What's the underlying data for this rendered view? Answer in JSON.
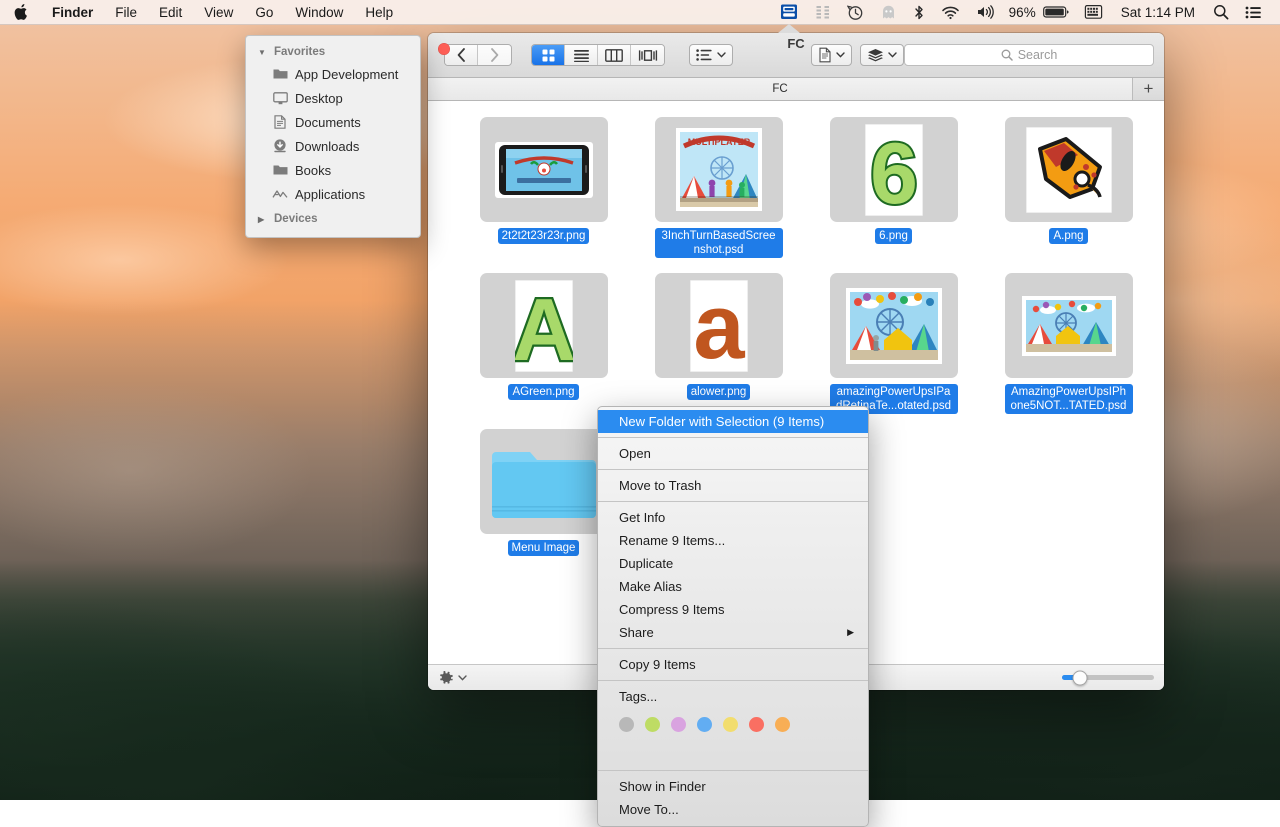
{
  "menubar": {
    "apple_glyph": "",
    "items": [
      {
        "label": "Finder",
        "bold": true
      },
      {
        "label": "File",
        "bold": false
      },
      {
        "label": "Edit",
        "bold": false
      },
      {
        "label": "View",
        "bold": false
      },
      {
        "label": "Go",
        "bold": false
      },
      {
        "label": "Window",
        "bold": false
      },
      {
        "label": "Help",
        "bold": false
      }
    ],
    "status": {
      "battery_percent": "96%",
      "clock": "Sat 1:14 PM"
    },
    "status_icons": [
      "finder-menu-extra-icon",
      "sort-arrows-icon",
      "time-machine-icon",
      "ghost-icon",
      "bluetooth-icon",
      "wifi-icon",
      "volume-icon",
      "battery-icon",
      "keyboard-input-icon",
      "spotlight-search-icon",
      "notification-center-icon"
    ]
  },
  "finder": {
    "window_title": "FC",
    "tab_title": "FC",
    "tab_add_label": "+",
    "nav": {
      "back": "‹",
      "forward": "›"
    },
    "view_modes": [
      {
        "name": "icon-view",
        "selected": true
      },
      {
        "name": "list-view",
        "selected": false
      },
      {
        "name": "column-view",
        "selected": false
      },
      {
        "name": "coverflow-view",
        "selected": false
      }
    ],
    "search": {
      "placeholder": "Search",
      "value": ""
    },
    "zoom_slider": {
      "value": 20
    },
    "action_gear_label": "⚙"
  },
  "sidebar": {
    "sections": [
      {
        "title": "Favorites",
        "expanded": true,
        "disclosure": "▼",
        "items": [
          {
            "label": "App Development",
            "icon": "folder-icon"
          },
          {
            "label": "Desktop",
            "icon": "display-icon"
          },
          {
            "label": "Documents",
            "icon": "document-icon"
          },
          {
            "label": "Downloads",
            "icon": "downloads-icon"
          },
          {
            "label": "Books",
            "icon": "folder-icon"
          },
          {
            "label": "Applications",
            "icon": "applications-icon"
          }
        ]
      },
      {
        "title": "Devices",
        "expanded": false,
        "disclosure": "▶",
        "items": []
      }
    ]
  },
  "files": [
    {
      "name": "2t2t2t23r23r.png",
      "kind": "png",
      "selected": true,
      "thumb": "phone-laugh-clown"
    },
    {
      "name": "3InchTurnBasedScreenshot.psd",
      "kind": "psd",
      "selected": true,
      "thumb": "multiplayer-carnival"
    },
    {
      "name": "6.png",
      "kind": "png",
      "selected": true,
      "thumb": "green-six"
    },
    {
      "name": "A.png",
      "kind": "png",
      "selected": true,
      "thumb": "orange-a-graffiti"
    },
    {
      "name": "AGreen.png",
      "kind": "png",
      "selected": true,
      "thumb": "green-a"
    },
    {
      "name": "alower.png",
      "kind": "png",
      "selected": true,
      "thumb": "orange-a-lower"
    },
    {
      "name": "amazingPowerUpsIPadRetinaTe...otated.psd",
      "kind": "psd",
      "selected": true,
      "thumb": "carnival-ipad"
    },
    {
      "name": "AmazingPowerUpsIPhone5NOT...TATED.psd",
      "kind": "psd",
      "selected": true,
      "thumb": "carnival-iphone"
    },
    {
      "name": "Menu Image",
      "kind": "folder",
      "selected": true,
      "thumb": "blue-folder"
    }
  ],
  "context_menu": {
    "groups": [
      {
        "items": [
          {
            "label": "New Folder with Selection (9 Items)",
            "highlighted": true,
            "submenu": false
          }
        ]
      },
      {
        "items": [
          {
            "label": "Open",
            "highlighted": false,
            "submenu": false
          }
        ]
      },
      {
        "items": [
          {
            "label": "Move to Trash",
            "highlighted": false,
            "submenu": false
          }
        ]
      },
      {
        "items": [
          {
            "label": "Get Info",
            "highlighted": false,
            "submenu": false
          },
          {
            "label": "Rename 9 Items...",
            "highlighted": false,
            "submenu": false
          },
          {
            "label": "Duplicate",
            "highlighted": false,
            "submenu": false
          },
          {
            "label": "Make Alias",
            "highlighted": false,
            "submenu": false
          },
          {
            "label": "Compress 9 Items",
            "highlighted": false,
            "submenu": false
          },
          {
            "label": "Share",
            "highlighted": false,
            "submenu": true,
            "arrow": "▶"
          }
        ]
      },
      {
        "items": [
          {
            "label": "Copy 9 Items",
            "highlighted": false,
            "submenu": false
          }
        ]
      },
      {
        "items": [
          {
            "label": "Tags...",
            "highlighted": false,
            "submenu": false
          }
        ]
      },
      {
        "items": [
          {
            "label": "Show in Finder",
            "highlighted": false,
            "submenu": false
          },
          {
            "label": "Move To...",
            "highlighted": false,
            "submenu": false
          }
        ]
      }
    ],
    "tag_colors": [
      "#b8b8b8",
      "#bedc64",
      "#d9a3e0",
      "#62adf2",
      "#f2dd6e",
      "#fa6f62",
      "#f8ae55"
    ],
    "tag_names": [
      "gray-tag",
      "green-tag",
      "purple-tag",
      "blue-tag",
      "yellow-tag",
      "red-tag",
      "orange-tag"
    ]
  },
  "colors": {
    "accent_blue": "#1f7ce8",
    "highlight_blue": "#2b8cf0",
    "close_red": "#ff5f57"
  }
}
